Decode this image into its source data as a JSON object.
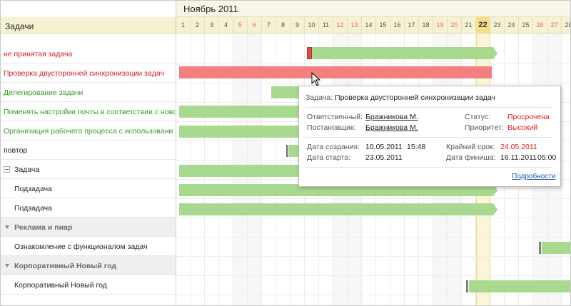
{
  "month": "Ноябрь 2011",
  "left_header": "Задачи",
  "days": [
    {
      "n": "1",
      "weekend": false
    },
    {
      "n": "2",
      "weekend": false
    },
    {
      "n": "3",
      "weekend": false
    },
    {
      "n": "4",
      "weekend": false
    },
    {
      "n": "5",
      "weekend": true
    },
    {
      "n": "6",
      "weekend": true
    },
    {
      "n": "7",
      "weekend": false
    },
    {
      "n": "8",
      "weekend": false
    },
    {
      "n": "9",
      "weekend": false
    },
    {
      "n": "10",
      "weekend": false
    },
    {
      "n": "11",
      "weekend": false
    },
    {
      "n": "12",
      "weekend": true
    },
    {
      "n": "13",
      "weekend": true
    },
    {
      "n": "14",
      "weekend": false
    },
    {
      "n": "15",
      "weekend": false
    },
    {
      "n": "16",
      "weekend": false
    },
    {
      "n": "17",
      "weekend": false
    },
    {
      "n": "18",
      "weekend": false
    },
    {
      "n": "19",
      "weekend": true
    },
    {
      "n": "20",
      "weekend": true
    },
    {
      "n": "21",
      "weekend": false
    },
    {
      "n": "22",
      "weekend": false,
      "today": true
    },
    {
      "n": "23",
      "weekend": false
    },
    {
      "n": "24",
      "weekend": false
    },
    {
      "n": "25",
      "weekend": false
    },
    {
      "n": "26",
      "weekend": true
    },
    {
      "n": "27",
      "weekend": true
    },
    {
      "n": "28",
      "weekend": false
    }
  ],
  "tasks": [
    {
      "label": "не принятая задача",
      "color": "#d22020",
      "kind": "task",
      "indent": 0
    },
    {
      "label": "Проверка двусторонней синхронизации задач",
      "color": "#d22020",
      "kind": "task",
      "indent": 0
    },
    {
      "label": "Делегирование задачи",
      "color": "#3a9a2a",
      "kind": "task",
      "indent": 0
    },
    {
      "label": "Поменять настройки почты в соответствии с ново",
      "color": "#3a9a2a",
      "kind": "task",
      "indent": 0
    },
    {
      "label": "Организация рабочего процесса с использовани",
      "color": "#3a9a2a",
      "kind": "task",
      "indent": 0
    },
    {
      "label": "повтор",
      "color": "#222222",
      "kind": "task",
      "indent": 0
    },
    {
      "label": "Задача",
      "color": "#222222",
      "kind": "parent",
      "indent": 0
    },
    {
      "label": "Подзадача",
      "color": "#222222",
      "kind": "task",
      "indent": 1
    },
    {
      "label": "Подзадача",
      "color": "#222222",
      "kind": "task",
      "indent": 1
    },
    {
      "label": "Реклама и пиар",
      "color": "#6a6a6a",
      "kind": "group",
      "indent": 0
    },
    {
      "label": "Ознакомление с функционалом задач",
      "color": "#222222",
      "kind": "task",
      "indent": 1
    },
    {
      "label": "Корпоративный Новый год",
      "color": "#6a6a6a",
      "kind": "group",
      "indent": 0
    },
    {
      "label": "Корпоративный Новый год",
      "color": "#222222",
      "kind": "task",
      "indent": 1
    }
  ],
  "popup": {
    "title_key": "Задача:",
    "title_value": "Проверка двусторонней синхронизации задач",
    "responsible_label": "Ответственный:",
    "responsible_value": "Бражникова М.",
    "creator_label": "Постановщик:",
    "creator_value": "Бражникова М.",
    "status_label": "Статус:",
    "status_value": "Просрочена",
    "priority_label": "Приоритет:",
    "priority_value": "Высокий",
    "created_label": "Дата создания:",
    "created_date": "10.05.2011",
    "created_time": "15:48",
    "deadline_label": "Крайний срок:",
    "deadline_value": "24.05.2011",
    "start_label": "Дата старта:",
    "start_value": "23.05.2011",
    "finish_label": "Дата финиша:",
    "finish_date": "16.11.2011",
    "finish_time": "05:00",
    "more_link": "Подробности"
  }
}
